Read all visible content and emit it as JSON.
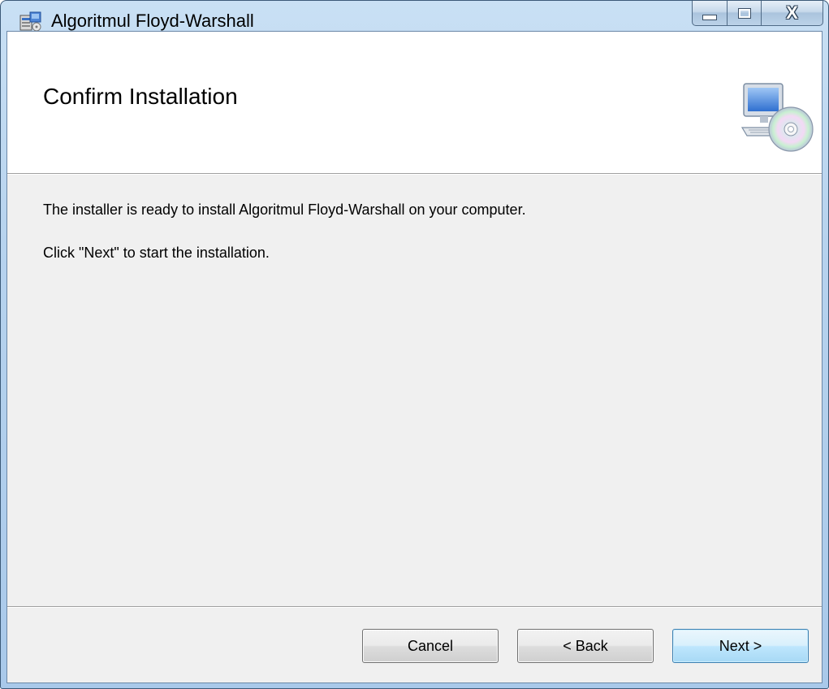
{
  "window": {
    "title": "Algoritmul Floyd-Warshall",
    "caption_close": "X"
  },
  "banner": {
    "title": "Confirm Installation",
    "icon": "computer-cd-icon"
  },
  "content": {
    "line1": "The installer is ready to install Algoritmul Floyd-Warshall on your computer.",
    "line2": "Click \"Next\" to start the installation."
  },
  "buttons": {
    "cancel": "Cancel",
    "back": "< Back",
    "next": "Next >"
  },
  "colors": {
    "frame": "#b7d3ee",
    "client_bg": "#f0f0f0",
    "default_button_border": "#3c7fb1"
  }
}
